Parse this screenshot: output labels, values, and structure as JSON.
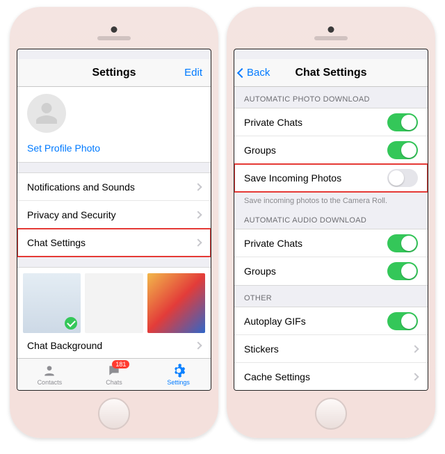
{
  "left": {
    "nav": {
      "title": "Settings",
      "edit": "Edit"
    },
    "profile": {
      "set_photo": "Set Profile Photo"
    },
    "rows": {
      "notifications": "Notifications and Sounds",
      "privacy": "Privacy and Security",
      "chat_settings": "Chat Settings",
      "chat_bg": "Chat Background"
    },
    "tabs": {
      "contacts": "Contacts",
      "chats": "Chats",
      "settings": "Settings",
      "chats_badge": "181"
    }
  },
  "right": {
    "nav": {
      "back": "Back",
      "title": "Chat Settings"
    },
    "sections": {
      "photo_header": "Automatic Photo Download",
      "audio_header": "Automatic Audio Download",
      "other_header": "Other",
      "save_footer": "Save incoming photos to the Camera Roll."
    },
    "rows": {
      "private_chats": "Private Chats",
      "groups": "Groups",
      "save_incoming": "Save Incoming Photos",
      "private_chats2": "Private Chats",
      "groups2": "Groups",
      "autoplay_gifs": "Autoplay GIFs",
      "stickers": "Stickers",
      "cache": "Cache Settings"
    },
    "toggles": {
      "private_chats": true,
      "groups": true,
      "save_incoming": false,
      "private_chats2": true,
      "groups2": true,
      "autoplay_gifs": true
    }
  }
}
